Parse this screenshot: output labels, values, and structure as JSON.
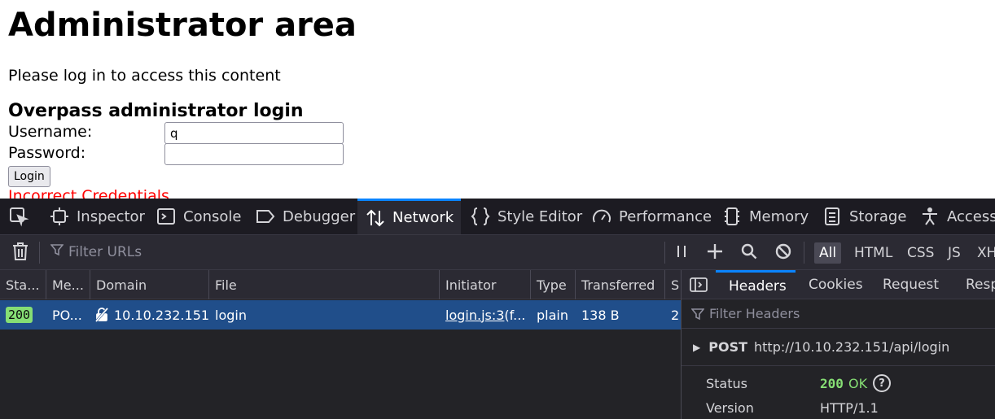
{
  "page": {
    "title": "Administrator area",
    "lead": "Please log in to access this content",
    "form_title": "Overpass administrator login",
    "username_label": "Username:",
    "username_value": "q",
    "password_label": "Password:",
    "password_value": "",
    "login_button": "Login",
    "error": "Incorrect Credentials"
  },
  "devtools": {
    "tabs": [
      {
        "label": "",
        "icon": "pick-element-icon"
      },
      {
        "label": "Inspector",
        "icon": "inspector-icon"
      },
      {
        "label": "Console",
        "icon": "console-icon"
      },
      {
        "label": "Debugger",
        "icon": "debugger-icon"
      },
      {
        "label": "Network",
        "icon": "network-icon",
        "active": true
      },
      {
        "label": "Style Editor",
        "icon": "style-editor-icon"
      },
      {
        "label": "Performance",
        "icon": "performance-icon"
      },
      {
        "label": "Memory",
        "icon": "memory-icon"
      },
      {
        "label": "Storage",
        "icon": "storage-icon"
      },
      {
        "label": "Accessi",
        "icon": "accessibility-icon"
      }
    ],
    "toolbar": {
      "filter_placeholder": "Filter URLs",
      "type_filters": [
        "All",
        "HTML",
        "CSS",
        "JS",
        "XH"
      ],
      "active_filter": "All"
    },
    "table": {
      "columns": [
        "Sta...",
        "Me...",
        "Domain",
        "File",
        "Initiator",
        "Type",
        "Transferred",
        "S"
      ],
      "rows": [
        {
          "status": "200",
          "method": "PO...",
          "domain": "10.10.232.151",
          "file": "login",
          "initiator_link": "login.js:3",
          "initiator_rest": " (f...",
          "type": "plain",
          "transferred": "138 B",
          "size": "2"
        }
      ]
    },
    "sidebar": {
      "tabs": [
        "Headers",
        "Cookies",
        "Request",
        "Resp"
      ],
      "active_tab": "Headers",
      "filter_placeholder": "Filter Headers",
      "request_method": "POST",
      "request_url": "http://10.10.232.151/api/login",
      "status_label": "Status",
      "status_code": "200",
      "status_text": "OK",
      "version_label": "Version",
      "version_value": "HTTP/1.1"
    },
    "colors": {
      "accent": "#0a84ff",
      "selected_row": "#204e8a",
      "status_ok": "#86de74",
      "error_text": "#ff0000"
    }
  }
}
